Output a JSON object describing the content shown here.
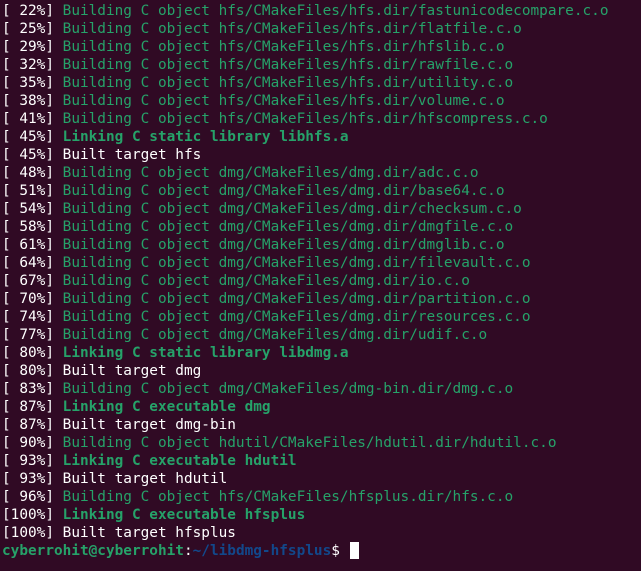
{
  "colors": {
    "background": "#300a24",
    "green": "#26a269",
    "blue": "#12488b",
    "text": "#ffffff"
  },
  "lines": [
    {
      "pct": "[ 22%]",
      "msg": "Building C object hfs/CMakeFiles/hfs.dir/fastunicodecompare.c.o",
      "style": "build"
    },
    {
      "pct": "[ 25%]",
      "msg": "Building C object hfs/CMakeFiles/hfs.dir/flatfile.c.o",
      "style": "build"
    },
    {
      "pct": "[ 29%]",
      "msg": "Building C object hfs/CMakeFiles/hfs.dir/hfslib.c.o",
      "style": "build"
    },
    {
      "pct": "[ 32%]",
      "msg": "Building C object hfs/CMakeFiles/hfs.dir/rawfile.c.o",
      "style": "build"
    },
    {
      "pct": "[ 35%]",
      "msg": "Building C object hfs/CMakeFiles/hfs.dir/utility.c.o",
      "style": "build"
    },
    {
      "pct": "[ 38%]",
      "msg": "Building C object hfs/CMakeFiles/hfs.dir/volume.c.o",
      "style": "build"
    },
    {
      "pct": "[ 41%]",
      "msg": "Building C object hfs/CMakeFiles/hfs.dir/hfscompress.c.o",
      "style": "build"
    },
    {
      "pct": "[ 45%]",
      "msg": "Linking C static library libhfs.a",
      "style": "link"
    },
    {
      "pct": "[ 45%]",
      "msg": "Built target hfs",
      "style": "plain"
    },
    {
      "pct": "[ 48%]",
      "msg": "Building C object dmg/CMakeFiles/dmg.dir/adc.c.o",
      "style": "build"
    },
    {
      "pct": "[ 51%]",
      "msg": "Building C object dmg/CMakeFiles/dmg.dir/base64.c.o",
      "style": "build"
    },
    {
      "pct": "[ 54%]",
      "msg": "Building C object dmg/CMakeFiles/dmg.dir/checksum.c.o",
      "style": "build"
    },
    {
      "pct": "[ 58%]",
      "msg": "Building C object dmg/CMakeFiles/dmg.dir/dmgfile.c.o",
      "style": "build"
    },
    {
      "pct": "[ 61%]",
      "msg": "Building C object dmg/CMakeFiles/dmg.dir/dmglib.c.o",
      "style": "build"
    },
    {
      "pct": "[ 64%]",
      "msg": "Building C object dmg/CMakeFiles/dmg.dir/filevault.c.o",
      "style": "build"
    },
    {
      "pct": "[ 67%]",
      "msg": "Building C object dmg/CMakeFiles/dmg.dir/io.c.o",
      "style": "build"
    },
    {
      "pct": "[ 70%]",
      "msg": "Building C object dmg/CMakeFiles/dmg.dir/partition.c.o",
      "style": "build"
    },
    {
      "pct": "[ 74%]",
      "msg": "Building C object dmg/CMakeFiles/dmg.dir/resources.c.o",
      "style": "build"
    },
    {
      "pct": "[ 77%]",
      "msg": "Building C object dmg/CMakeFiles/dmg.dir/udif.c.o",
      "style": "build"
    },
    {
      "pct": "[ 80%]",
      "msg": "Linking C static library libdmg.a",
      "style": "link"
    },
    {
      "pct": "[ 80%]",
      "msg": "Built target dmg",
      "style": "plain"
    },
    {
      "pct": "[ 83%]",
      "msg": "Building C object dmg/CMakeFiles/dmg-bin.dir/dmg.c.o",
      "style": "build"
    },
    {
      "pct": "[ 87%]",
      "msg": "Linking C executable dmg",
      "style": "link"
    },
    {
      "pct": "[ 87%]",
      "msg": "Built target dmg-bin",
      "style": "plain"
    },
    {
      "pct": "[ 90%]",
      "msg": "Building C object hdutil/CMakeFiles/hdutil.dir/hdutil.c.o",
      "style": "build"
    },
    {
      "pct": "[ 93%]",
      "msg": "Linking C executable hdutil",
      "style": "link"
    },
    {
      "pct": "[ 93%]",
      "msg": "Built target hdutil",
      "style": "plain"
    },
    {
      "pct": "[ 96%]",
      "msg": "Building C object hfs/CMakeFiles/hfsplus.dir/hfs.c.o",
      "style": "build"
    },
    {
      "pct": "[100%]",
      "msg": "Linking C executable hfsplus",
      "style": "link"
    },
    {
      "pct": "[100%]",
      "msg": "Built target hfsplus",
      "style": "plain"
    }
  ],
  "prompt": {
    "user_host": "cyberrohit@cyberrohit",
    "separator": ":",
    "path": "~/libdmg-hfsplus",
    "symbol": "$ "
  }
}
